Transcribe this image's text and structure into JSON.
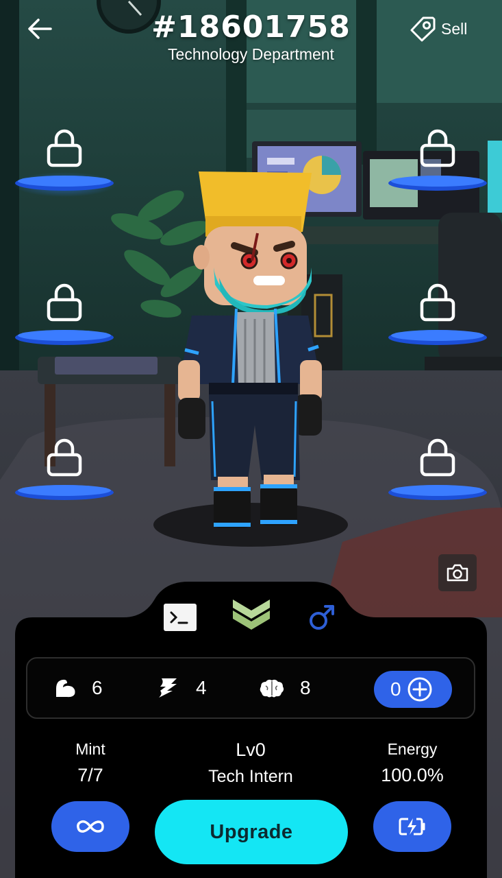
{
  "header": {
    "title": "#18601758",
    "subtitle": "Technology Department",
    "sell_label": "Sell"
  },
  "icons": {
    "back": "arrow-left-icon",
    "sell": "price-tag-icon",
    "lock": "lock-icon",
    "camera": "camera-icon",
    "terminal": "terminal-icon",
    "rank": "chevron-rank-icon",
    "gender": "male-symbol-icon",
    "strength": "bicep-icon",
    "agility": "speed-icon",
    "intellect": "brain-icon",
    "add": "plus-circle-icon",
    "mint": "infinity-link-icon",
    "recharge": "battery-bolt-icon"
  },
  "stats": {
    "strength": "6",
    "agility": "4",
    "intellect": "8",
    "points": "0"
  },
  "info": {
    "mint_label": "Mint",
    "mint_value": "7/7",
    "level_label": "Lv0",
    "level_title": "Tech Intern",
    "energy_label": "Energy",
    "energy_value": "100.0%"
  },
  "actions": {
    "upgrade_label": "Upgrade"
  },
  "colors": {
    "accent_blue": "#2f63e8",
    "upgrade_cyan": "#14e6f4",
    "panel_black": "#000000",
    "rank_green": "#b8d89a",
    "gender_blue": "#2e5fd6"
  }
}
